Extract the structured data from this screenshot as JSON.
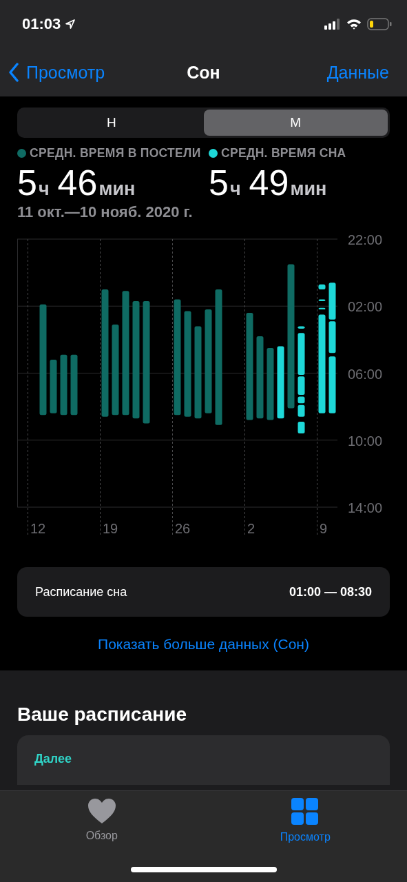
{
  "status_bar": {
    "time": "01:03"
  },
  "nav": {
    "back": "Просмотр",
    "title": "Сон",
    "action": "Данные"
  },
  "segments": [
    {
      "label": "Н",
      "selected": false
    },
    {
      "label": "М",
      "selected": true
    }
  ],
  "stats": [
    {
      "label": "СРЕДН. ВРЕМЯ В ПОСТЕЛИ",
      "color": "#0f6b63",
      "hours": "5",
      "hours_unit": "ч",
      "minutes": "46",
      "minutes_unit": "мин"
    },
    {
      "label": "СРЕДН. ВРЕМЯ СНА",
      "color": "#1ed8d8",
      "hours": "5",
      "hours_unit": "ч",
      "minutes": "49",
      "minutes_unit": "мин"
    }
  ],
  "date_range": "11 окт.—10 нояб. 2020 г.",
  "chart": {
    "y_labels": [
      "22:00",
      "02:00",
      "06:00",
      "10:00",
      "14:00"
    ],
    "x_labels": [
      "12",
      "19",
      "26",
      "2",
      "9"
    ]
  },
  "schedule_row": {
    "label": "Расписание сна",
    "value": "01:00 — 08:30"
  },
  "more_link": "Показать больше данных (Сон)",
  "your_schedule": {
    "title": "Ваше расписание",
    "card": {
      "heading": "Далее"
    }
  },
  "tab_bar": [
    {
      "kind": "heart",
      "label": "Обзор",
      "selected": false
    },
    {
      "kind": "grid",
      "label": "Просмотр",
      "selected": true
    }
  ]
}
